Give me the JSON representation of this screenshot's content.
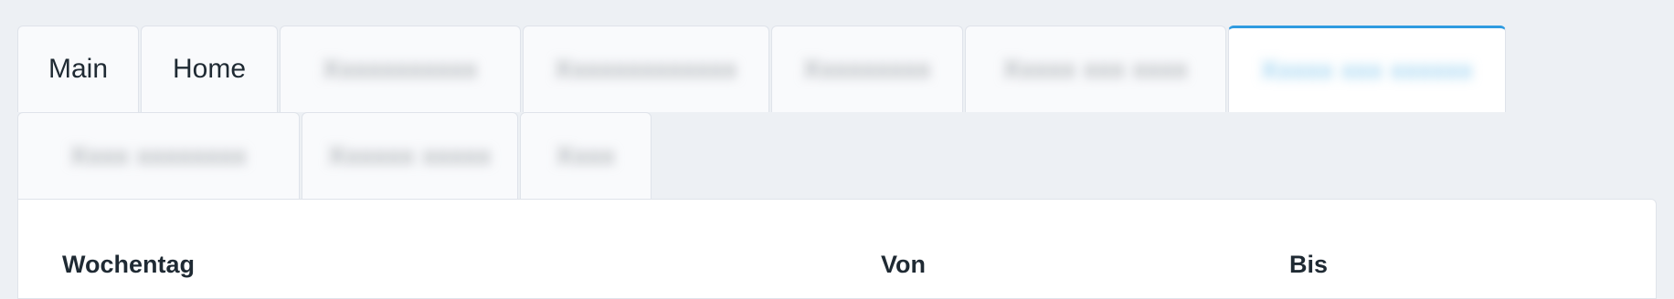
{
  "tabs_row1": [
    {
      "label": "Main",
      "blurred": false,
      "active": false
    },
    {
      "label": "Home",
      "blurred": false,
      "active": false
    },
    {
      "label": "Xxxxxxxxxxx",
      "blurred": true,
      "active": false
    },
    {
      "label": "Xxxxxxxxxxxxx",
      "blurred": true,
      "active": false
    },
    {
      "label": "Xxxxxxxxx",
      "blurred": true,
      "active": false
    },
    {
      "label": "Xxxxx xxx xxxx",
      "blurred": true,
      "active": false
    },
    {
      "label": "Xxxxx xxx xxxxxx",
      "blurred": true,
      "active": true
    }
  ],
  "tabs_row2": [
    {
      "label": "Xxxx xxxxxxxx",
      "blurred": true,
      "active": false
    },
    {
      "label": "Xxxxxx xxxxx",
      "blurred": true,
      "active": false
    },
    {
      "label": "Xxxx",
      "blurred": true,
      "active": false
    }
  ],
  "table": {
    "col_weekday": "Wochentag",
    "col_from": "Von",
    "col_to": "Bis"
  },
  "colors": {
    "accent": "#2f9be0",
    "background": "#edf0f4"
  }
}
